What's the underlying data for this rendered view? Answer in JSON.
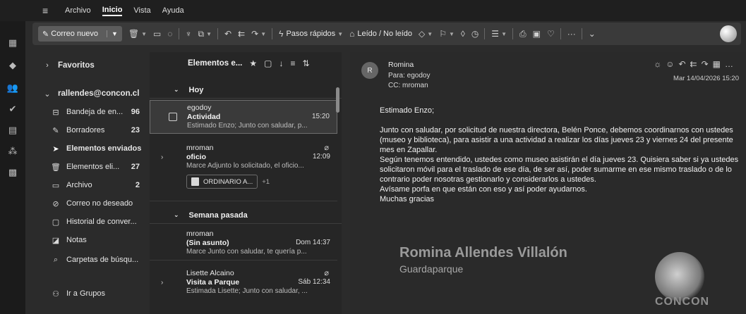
{
  "menubar": {
    "items": [
      "Archivo",
      "Inicio",
      "Vista",
      "Ayuda"
    ]
  },
  "toolbar": {
    "new_mail": "Correo nuevo",
    "quick_steps": "Pasos rápidos",
    "read_unread": "Leído / No leído"
  },
  "folders": {
    "favorites": "Favoritos",
    "account": "rallendes@concon.cl",
    "items": [
      {
        "label": "Bandeja de en...",
        "count": "96",
        "icon": "inbox-icon"
      },
      {
        "label": "Borradores",
        "count": "23",
        "icon": "pencil-icon"
      },
      {
        "label": "Elementos enviados",
        "count": "",
        "icon": "send-icon"
      },
      {
        "label": "Elementos eli...",
        "count": "27",
        "icon": "trash-icon"
      },
      {
        "label": "Archivo",
        "count": "2",
        "icon": "archive-icon"
      },
      {
        "label": "Correo no deseado",
        "count": "",
        "icon": "junk-icon"
      },
      {
        "label": "Historial de conver...",
        "count": "",
        "icon": "history-icon"
      },
      {
        "label": "Notas",
        "count": "",
        "icon": "notes-icon"
      },
      {
        "label": "Carpetas de búsqu...",
        "count": "",
        "icon": "search-folder-icon"
      },
      {
        "label": "Ir a Grupos",
        "count": "",
        "icon": "groups-icon"
      }
    ]
  },
  "msglist": {
    "title": "Elementos e...",
    "groups": {
      "today": "Hoy",
      "last_week": "Semana pasada"
    },
    "messages": [
      {
        "from": "egodoy",
        "subject": "Actividad",
        "time": "15:20",
        "preview": "Estimado Enzo; Junto con saludar, p..."
      },
      {
        "from": "mroman",
        "subject": "oficio",
        "time": "12:09",
        "preview": "Marce Adjunto lo solicitado, el oficio...",
        "attachment": "ORDINARIO A...",
        "more": "+1"
      },
      {
        "from": "mroman",
        "subject": "(Sin asunto)",
        "time": "Dom 14:37",
        "preview": "Marce Junto con saludar, te quería p..."
      },
      {
        "from": "Lisette Alcaino",
        "subject": "Visita a Parque",
        "time": "Sáb 12:34",
        "preview": "Estimada Lisette; Junto con saludar, ..."
      }
    ]
  },
  "reading": {
    "avatar": "R",
    "from": "Romina",
    "to": "Para: egodoy",
    "cc": "CC: mroman",
    "date": "Mar 14/04/2026 15:20",
    "greeting": "Estimado Enzo;",
    "para1": "Junto con saludar, por solicitud de nuestra directora, Belén Ponce,  debemos coordinarnos con ustedes (museo y biblioteca), para asistir a una actividad a realizar los días jueves 23 y viernes 24 del presente mes en Zapallar.",
    "para2": "Según tenemos entendido, ustedes como museo asistirán el día jueves 23. Quisiera saber si ya ustedes solicitaron móvil para el traslado de ese día, de ser así, poder sumarme en ese mismo traslado o de lo contrario poder nosotras  gestionarlo y considerarlos a ustedes.",
    "para3": "Avísame porfa en que están con eso y así poder ayudarnos.",
    "closing": "Muchas gracias",
    "signature_name": "Romina Allendes Villalón",
    "signature_role": "Guardaparque",
    "logo_text": "CONCON"
  }
}
